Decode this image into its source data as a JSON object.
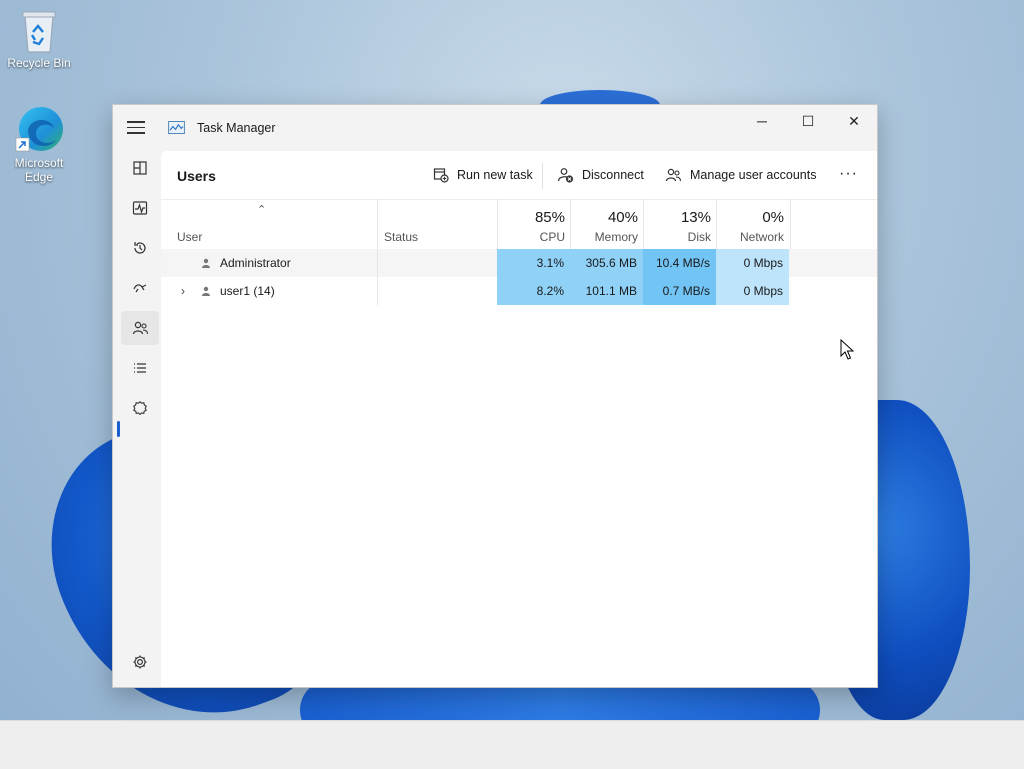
{
  "desktop": {
    "icons": [
      {
        "label": "Recycle Bin",
        "icon": "recycle-bin-icon"
      },
      {
        "label": "Microsoft Edge",
        "icon": "edge-icon"
      }
    ]
  },
  "window": {
    "title": "Task Manager",
    "app_icon": "task-manager-icon",
    "controls": {
      "minimize": "─",
      "maximize": "☐",
      "close": "✕"
    }
  },
  "nav": {
    "items": [
      {
        "name": "processes",
        "icon": "processes-icon"
      },
      {
        "name": "performance",
        "icon": "performance-icon"
      },
      {
        "name": "app-history",
        "icon": "history-icon"
      },
      {
        "name": "startup-apps",
        "icon": "startup-icon"
      },
      {
        "name": "users",
        "icon": "users-icon",
        "active": true
      },
      {
        "name": "details",
        "icon": "details-list-icon"
      },
      {
        "name": "services",
        "icon": "services-icon"
      }
    ],
    "settings_icon": "gear-icon"
  },
  "page": {
    "title": "Users",
    "commands": {
      "run_new_task": "Run new task",
      "disconnect": "Disconnect",
      "manage_accounts": "Manage user accounts",
      "more": "···"
    }
  },
  "table": {
    "columns": {
      "user": "User",
      "status": "Status",
      "cpu": {
        "pct": "85%",
        "label": "CPU"
      },
      "memory": {
        "pct": "40%",
        "label": "Memory"
      },
      "disk": {
        "pct": "13%",
        "label": "Disk"
      },
      "network": {
        "pct": "0%",
        "label": "Network"
      }
    },
    "rows": [
      {
        "user": "Administrator",
        "status": "",
        "cpu": "3.1%",
        "memory": "305.6 MB",
        "disk": "10.4 MB/s",
        "network": "0 Mbps",
        "expandable": false
      },
      {
        "user": "user1 (14)",
        "status": "",
        "cpu": "8.2%",
        "memory": "101.1 MB",
        "disk": "0.7 MB/s",
        "network": "0 Mbps",
        "expandable": true
      }
    ]
  },
  "colors": {
    "accent": "#1a5fd0",
    "heat_light": "#bde4fb",
    "heat_mid": "#8fd1f7",
    "heat_strong": "#72c4f5"
  }
}
